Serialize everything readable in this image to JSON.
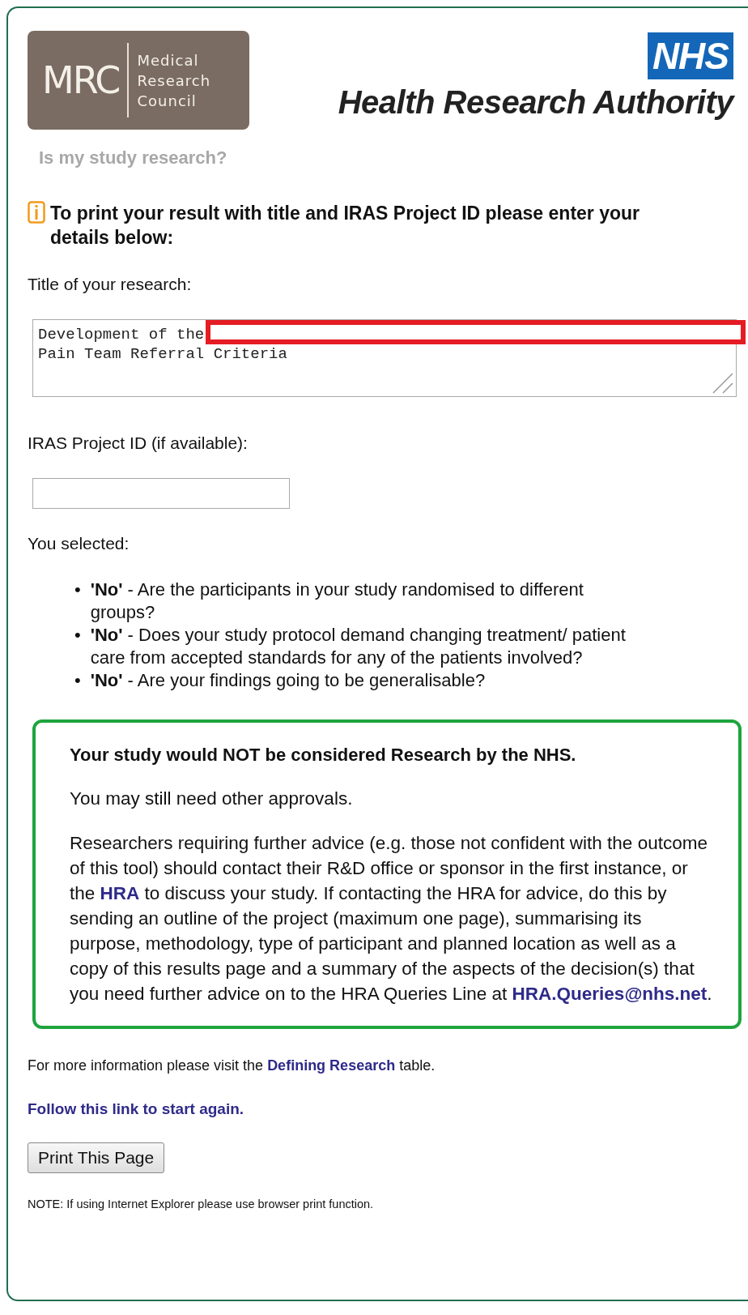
{
  "header": {
    "mrc_logo": {
      "abbr": "MRC",
      "lines": [
        "Medical",
        "Research",
        "Council"
      ]
    },
    "nhs_logo": "NHS",
    "authority": "Health Research Authority"
  },
  "page_title": "Is my study research?",
  "info_note": "To print your result with title and IRAS Project ID please enter your details below:",
  "title_field": {
    "label": "Title of your research:",
    "lines": [
      "Development of the",
      "Pain Team Referral Criteria"
    ],
    "redacted": true
  },
  "iras_field": {
    "label": "IRAS Project ID (if available):"
  },
  "selected_label": "You selected:",
  "selections": [
    {
      "marker": "•",
      "text": "**'No'** - Are the participants in your study randomised to different groups?"
    },
    {
      "marker": "•",
      "text": "**'No'** - Does your study protocol demand changing treatment/ patient care from accepted standards for any of the patients involved?"
    },
    {
      "marker": "•",
      "text": "**'No'** - Are your findings going to be generalisable?"
    }
  ],
  "result": {
    "heading": "Your study would NOT be considered Research by the NHS.",
    "note": "You may still need other approvals.",
    "advice": [
      {
        "kind": "text",
        "text": "Researchers requiring further advice (e.g. those not confident with the outcome of this tool) should contact their R&D office or sponsor in the first instance, or the "
      },
      {
        "kind": "link",
        "text": "HRA"
      },
      {
        "kind": "text",
        "text": " to discuss your study. If contacting the HRA for advice, do this by sending an outline of the project (maximum one page), summarising its purpose, methodology, type of participant and planned location as well as a copy of this results page and a summary of the aspects of the decision(s) that you need further advice on to the HRA Queries Line at "
      },
      {
        "kind": "link",
        "text": "HRA.Queries@nhs.net"
      },
      {
        "kind": "text",
        "text": "."
      }
    ]
  },
  "more_info": [
    {
      "kind": "text",
      "text": "For more information please visit the "
    },
    {
      "kind": "link",
      "text": "Defining Research"
    },
    {
      "kind": "text",
      "text": " table."
    }
  ],
  "restart_link": "Follow this link to start again.",
  "print_button": "Print This Page",
  "footnote": "NOTE: If using Internet Explorer please use browser print function."
}
